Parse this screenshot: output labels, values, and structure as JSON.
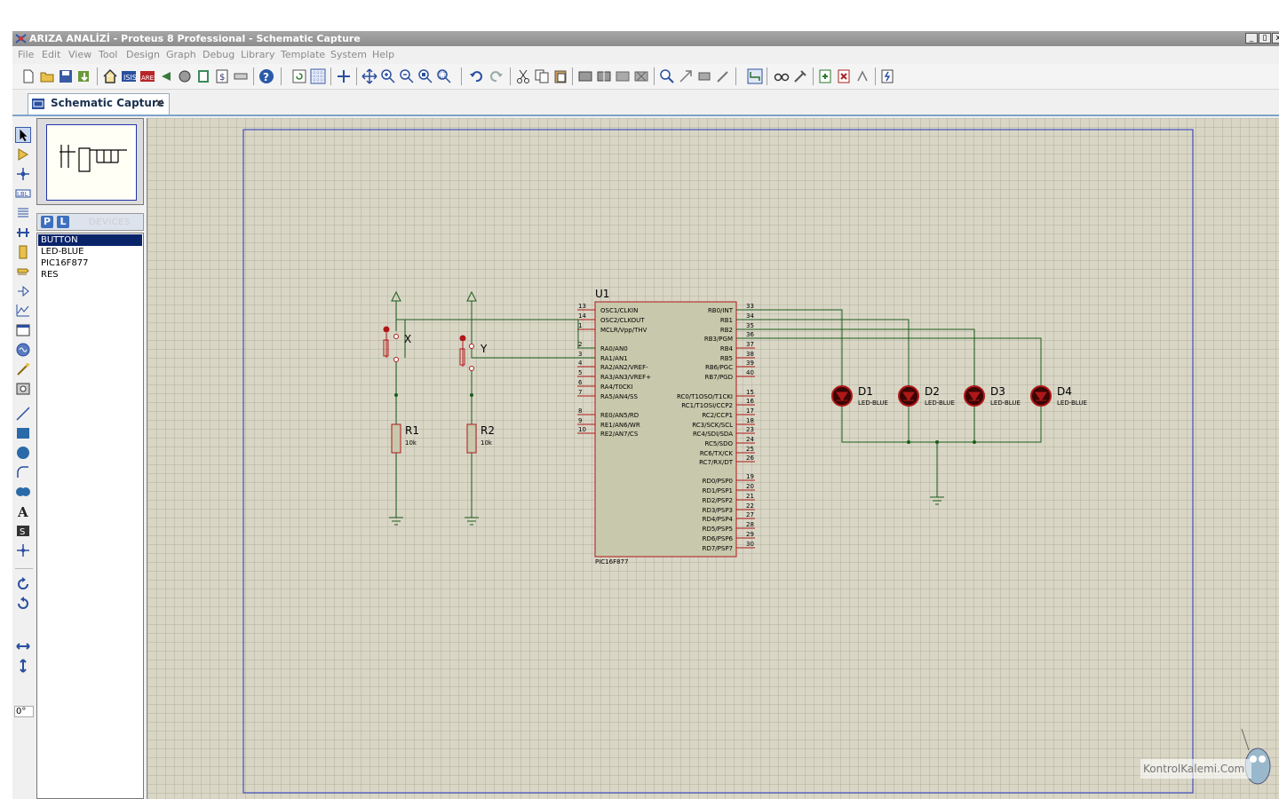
{
  "window": {
    "title": "ARIZA ANALİZİ - Proteus 8 Professional - Schematic Capture",
    "controls": [
      "_",
      "▯",
      "x"
    ]
  },
  "menu": [
    "File",
    "Edit",
    "View",
    "Tool",
    "Design",
    "Graph",
    "Debug",
    "Library",
    "Template",
    "System",
    "Help"
  ],
  "tab": {
    "label": "Schematic Capture",
    "close": "×"
  },
  "devices": {
    "header_p": "P",
    "header_l": "L",
    "title": "DEVICES",
    "items": [
      "BUTTON",
      "LED-BLUE",
      "PIC16F877",
      "RES"
    ],
    "selected": "BUTTON"
  },
  "rotation": "0°",
  "schematic": {
    "mcu": {
      "ref": "U1",
      "part": "PIC16F877",
      "left_pins": [
        {
          "num": "13",
          "name": "OSC1/CLKIN"
        },
        {
          "num": "14",
          "name": "OSC2/CLKOUT"
        },
        {
          "num": "1",
          "name": "MCLR/Vpp/THV"
        },
        {
          "num": "2",
          "name": "RA0/AN0"
        },
        {
          "num": "3",
          "name": "RA1/AN1"
        },
        {
          "num": "4",
          "name": "RA2/AN2/VREF-"
        },
        {
          "num": "5",
          "name": "RA3/AN3/VREF+"
        },
        {
          "num": "6",
          "name": "RA4/T0CKI"
        },
        {
          "num": "7",
          "name": "RA5/AN4/SS"
        },
        {
          "num": "8",
          "name": "RE0/AN5/RD"
        },
        {
          "num": "9",
          "name": "RE1/AN6/WR"
        },
        {
          "num": "10",
          "name": "RE2/AN7/CS"
        }
      ],
      "right_pins": [
        {
          "num": "33",
          "name": "RB0/INT"
        },
        {
          "num": "34",
          "name": "RB1"
        },
        {
          "num": "35",
          "name": "RB2"
        },
        {
          "num": "36",
          "name": "RB3/PGM"
        },
        {
          "num": "37",
          "name": "RB4"
        },
        {
          "num": "38",
          "name": "RB5"
        },
        {
          "num": "39",
          "name": "RB6/PGC"
        },
        {
          "num": "40",
          "name": "RB7/PGD"
        },
        {
          "num": "15",
          "name": "RC0/T1OSO/T1CKI"
        },
        {
          "num": "16",
          "name": "RC1/T1OSI/CCP2"
        },
        {
          "num": "17",
          "name": "RC2/CCP1"
        },
        {
          "num": "18",
          "name": "RC3/SCK/SCL"
        },
        {
          "num": "23",
          "name": "RC4/SDI/SDA"
        },
        {
          "num": "24",
          "name": "RC5/SDO"
        },
        {
          "num": "25",
          "name": "RC6/TX/CK"
        },
        {
          "num": "26",
          "name": "RC7/RX/DT"
        },
        {
          "num": "19",
          "name": "RD0/PSP0"
        },
        {
          "num": "20",
          "name": "RD1/PSP1"
        },
        {
          "num": "21",
          "name": "RD2/PSP2"
        },
        {
          "num": "22",
          "name": "RD3/PSP3"
        },
        {
          "num": "27",
          "name": "RD4/PSP4"
        },
        {
          "num": "28",
          "name": "RD5/PSP5"
        },
        {
          "num": "29",
          "name": "RD6/PSP6"
        },
        {
          "num": "30",
          "name": "RD7/PSP7"
        }
      ]
    },
    "leds": [
      {
        "ref": "D1",
        "part": "LED-BLUE"
      },
      {
        "ref": "D2",
        "part": "LED-BLUE"
      },
      {
        "ref": "D3",
        "part": "LED-BLUE"
      },
      {
        "ref": "D4",
        "part": "LED-BLUE"
      }
    ],
    "resistors": [
      {
        "ref": "R1",
        "value": "10k"
      },
      {
        "ref": "R2",
        "value": "10k"
      }
    ],
    "buttons": [
      {
        "label": "X"
      },
      {
        "label": "Y"
      }
    ]
  },
  "watermark": "KontrolKalemi.Com",
  "colors": {
    "canvas": "#d9d6c6",
    "wire": "#1a5c1a",
    "component": "#b01818",
    "sheet_border": "#2233bb",
    "selection": "#0a246a"
  }
}
